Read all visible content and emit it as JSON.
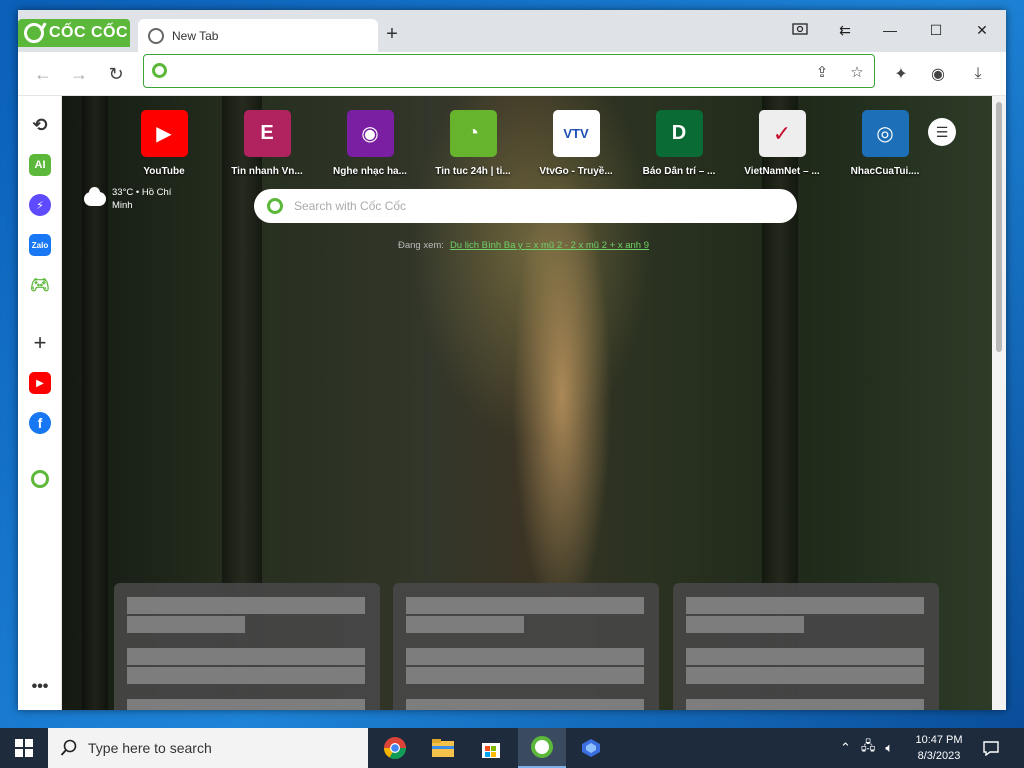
{
  "browser": {
    "brand": "CỐC CỐC",
    "tab": {
      "title": "New Tab"
    },
    "omnibox": {
      "value": ""
    }
  },
  "shortcuts": [
    {
      "label": "YouTube",
      "icon": "youtube-icon",
      "color": "#ff0000",
      "glyph": "▶"
    },
    {
      "label": "Tin nhanh Vn...",
      "icon": "vnexpress-icon",
      "color": "#b0235f",
      "glyph": "E"
    },
    {
      "label": "Nghe nhạc ha...",
      "icon": "music-icon",
      "color": "#7a1fa2",
      "glyph": "◉"
    },
    {
      "label": "Tin tuc 24h | ti...",
      "icon": "24h-icon",
      "color": "#66b32e",
      "glyph": "◔"
    },
    {
      "label": "VtvGo - Truyề...",
      "icon": "vtvgo-icon",
      "color": "#ffffff",
      "glyph": "VTV"
    },
    {
      "label": "Báo Dân trí – ...",
      "icon": "dantri-icon",
      "color": "#0b6b34",
      "glyph": "D"
    },
    {
      "label": "VietNamNet – ...",
      "icon": "vietnamnet-icon",
      "color": "#eeeeee",
      "glyph": "✓"
    },
    {
      "label": "NhacCuaTui....",
      "icon": "nhaccuatui-icon",
      "color": "#1d6fb8",
      "glyph": "◎"
    }
  ],
  "weather": {
    "text": "33°C • Hồ Chí Minh"
  },
  "search": {
    "placeholder": "Search with Cốc Cốc"
  },
  "suggestion": {
    "prefix": "Đang xem:",
    "link": "Du lịch Bình Ba y = x mũ 2 - 2 x mũ 2 + x anh 9"
  },
  "taskbar": {
    "search_placeholder": "Type here to search",
    "time": "10:47 PM",
    "date": "8/3/2023"
  },
  "colors": {
    "brand_green": "#5cb83a",
    "taskbar": "#1d2b3c"
  }
}
